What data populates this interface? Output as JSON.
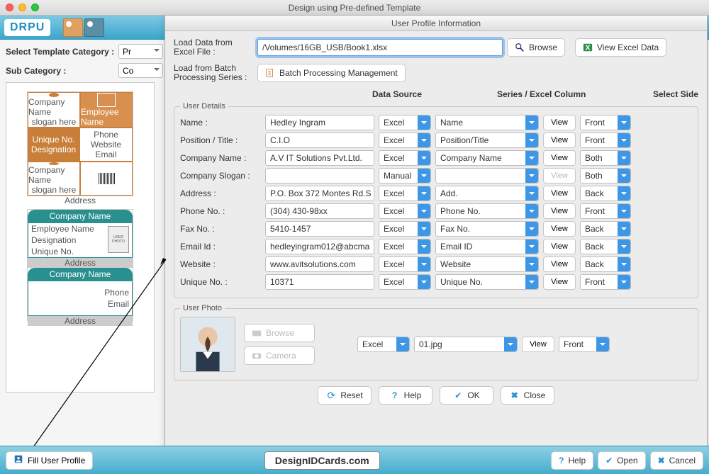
{
  "window": {
    "title": "Design using Pre-defined Template"
  },
  "header": {
    "logo": "DRPU"
  },
  "leftPanel": {
    "selectTemplateCategoryLabel": "Select Template Category :",
    "selectTemplateCategoryValue": "Pr",
    "subCategoryLabel": "Sub Category :",
    "subCategoryValue": "Co",
    "card1": {
      "companyName": "Company Name",
      "slogan": "slogan here",
      "employeeName": "Employee Name",
      "uniqueNo": "Unique No.",
      "designation": "Designation",
      "phone": "Phone",
      "website": "Website",
      "email": "Email",
      "address": "Address"
    },
    "card2": {
      "companyName": "Company Name",
      "employeeName": "Employee Name",
      "designation": "Designation",
      "uniqueNo": "Unique No.",
      "userPhoto": "USER PHOTO",
      "address": "Address",
      "phone": "Phone",
      "email": "Email"
    }
  },
  "dialog": {
    "title": "User Profile Information",
    "loadDataLabel": "Load Data from Excel File :",
    "excelPath": "/Volumes/16GB_USB/Book1.xlsx",
    "browse": "Browse",
    "viewExcelData": "View Excel Data",
    "loadBatchLabel": "Load from Batch Processing Series :",
    "batchBtn": "Batch Processing Management",
    "userDetailsLegend": "User Details",
    "userPhotoLegend": "User Photo",
    "columns": {
      "dataSource": "Data Source",
      "seriesCol": "Series / Excel Column",
      "selectSide": "Select Side"
    },
    "rows": [
      {
        "label": "Name :",
        "value": "Hedley Ingram",
        "source": "Excel",
        "col": "Name",
        "view": "View",
        "side": "Front",
        "viewEnabled": true
      },
      {
        "label": "Position / Title :",
        "value": "C.I.O",
        "source": "Excel",
        "col": "Position/Title",
        "view": "View",
        "side": "Front",
        "viewEnabled": true
      },
      {
        "label": "Company Name :",
        "value": "A.V IT Solutions Pvt.Ltd.",
        "source": "Excel",
        "col": "Company Name",
        "view": "View",
        "side": "Both",
        "viewEnabled": true
      },
      {
        "label": "Company Slogan :",
        "value": "",
        "source": "Manual",
        "col": "",
        "view": "View",
        "side": "Both",
        "viewEnabled": false
      },
      {
        "label": "Address :",
        "value": "P.O. Box 372 Montes Rd.S",
        "source": "Excel",
        "col": "Add.",
        "view": "View",
        "side": "Back",
        "viewEnabled": true
      },
      {
        "label": "Phone No. :",
        "value": "(304) 430-98xx",
        "source": "Excel",
        "col": "Phone No.",
        "view": "View",
        "side": "Front",
        "viewEnabled": true
      },
      {
        "label": "Fax No. :",
        "value": "5410-1457",
        "source": "Excel",
        "col": "Fax No.",
        "view": "View",
        "side": "Back",
        "viewEnabled": true
      },
      {
        "label": "Email Id :",
        "value": "hedleyingram012@abcma",
        "source": "Excel",
        "col": "Email ID",
        "view": "View",
        "side": "Back",
        "viewEnabled": true
      },
      {
        "label": "Website :",
        "value": "www.avitsolutions.com",
        "source": "Excel",
        "col": "Website",
        "view": "View",
        "side": "Back",
        "viewEnabled": true
      },
      {
        "label": "Unique No. :",
        "value": "10371",
        "source": "Excel",
        "col": "Unique No.",
        "view": "View",
        "side": "Front",
        "viewEnabled": true
      }
    ],
    "photo": {
      "browse": "Browse",
      "camera": "Camera",
      "source": "Excel",
      "col": "01.jpg",
      "view": "View",
      "side": "Front"
    },
    "footer": {
      "reset": "Reset",
      "help": "Help",
      "ok": "OK",
      "close": "Close"
    }
  },
  "status": {
    "fillProfile": "Fill User Profile",
    "url": "DesignIDCards.com",
    "help": "Help",
    "open": "Open",
    "cancel": "Cancel"
  }
}
